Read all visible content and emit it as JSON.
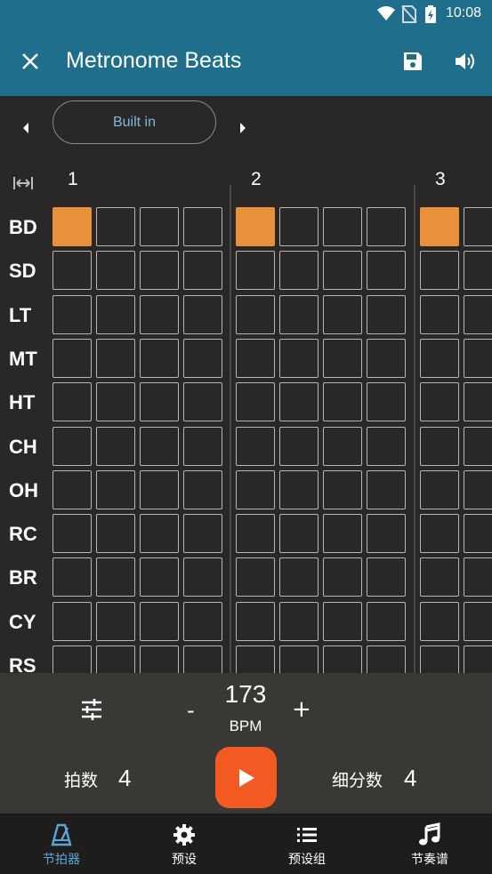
{
  "status_bar": {
    "time": "10:08"
  },
  "app_bar": {
    "title": "Metronome Beats"
  },
  "preset": {
    "name": "Built in"
  },
  "grid": {
    "beat_numbers": [
      "1",
      "2",
      "3"
    ],
    "rows": [
      "BD",
      "SD",
      "LT",
      "MT",
      "HT",
      "CH",
      "OH",
      "RC",
      "BR",
      "CY",
      "RS"
    ],
    "active_cells": [
      {
        "row": "BD",
        "beat": 1,
        "sub": 1
      },
      {
        "row": "BD",
        "beat": 2,
        "sub": 1
      },
      {
        "row": "BD",
        "beat": 3,
        "sub": 1
      }
    ],
    "subdivisions_per_beat": 4
  },
  "controls": {
    "bpm_value": "173",
    "bpm_unit": "BPM",
    "minus": "-",
    "plus": "+",
    "beats_label": "拍数",
    "beats_value": "4",
    "subdivision_label": "细分数",
    "subdivision_value": "4"
  },
  "bottom_nav": [
    {
      "label": "节拍器",
      "icon": "metronome-icon",
      "active": true
    },
    {
      "label": "预设",
      "icon": "gear-icon",
      "active": false
    },
    {
      "label": "预设组",
      "icon": "list-icon",
      "active": false
    },
    {
      "label": "节奏谱",
      "icon": "music-note-icon",
      "active": false
    }
  ],
  "colors": {
    "app_bar": "#1f6e8c",
    "background": "#2a2826",
    "active_cell": "#e8913a",
    "play_button": "#f25a22",
    "nav_active": "#5aa6d6"
  }
}
